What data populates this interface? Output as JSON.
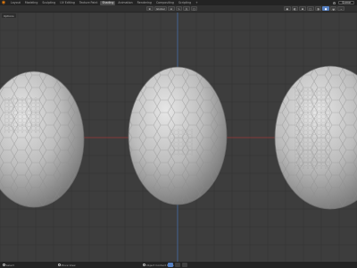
{
  "topbar": {
    "logo_glyph": "◉",
    "tabs": [
      {
        "label": "Layout",
        "active": false
      },
      {
        "label": "Modeling",
        "active": false
      },
      {
        "label": "Sculpting",
        "active": false
      },
      {
        "label": "UV Editing",
        "active": false
      },
      {
        "label": "Texture Paint",
        "active": false
      },
      {
        "label": "Shading",
        "active": true
      },
      {
        "label": "Animation",
        "active": false
      },
      {
        "label": "Rendering",
        "active": false
      },
      {
        "label": "Compositing",
        "active": false
      },
      {
        "label": "Scripting",
        "active": false
      },
      {
        "label": "+",
        "active": false
      }
    ],
    "scene_label": "Scene",
    "scene_icon_glyph": "⚙"
  },
  "header": {
    "center_items": [
      "⊕",
      "Global",
      "⊡",
      "∿",
      "⋀",
      "○"
    ],
    "right_items": [
      "◉",
      "◐",
      "⊞",
      "▢",
      "◑",
      "●",
      "◒",
      "⌄"
    ]
  },
  "tool_options_label": "Options",
  "status": {
    "left_label": "Select",
    "middle_label": "Move View",
    "right_label": "Object Context Menu"
  },
  "colors": {
    "viewport_bg": "#3d3d3d",
    "grid_line": "#353535",
    "x_axis": "#9b3a3a",
    "y_axis": "#4a70a8",
    "mesh_base": "#b8b8b8",
    "mesh_edge": "#8d8d8d"
  }
}
